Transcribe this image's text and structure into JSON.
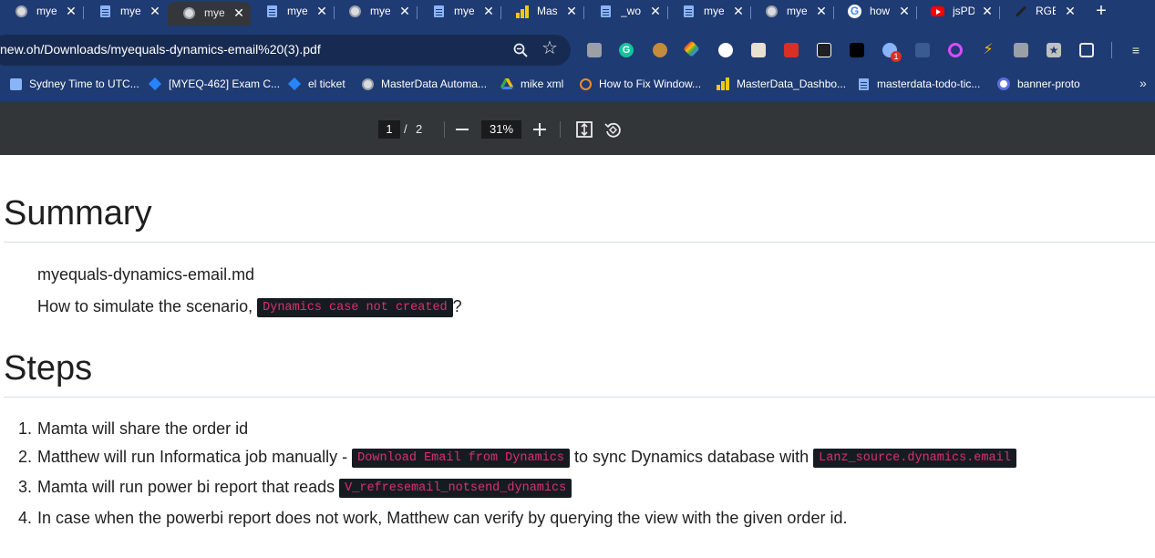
{
  "tabs": [
    {
      "title": "mye",
      "icon": "globe-icon",
      "active": false
    },
    {
      "title": "mye",
      "icon": "doc-icon",
      "active": false
    },
    {
      "title": "mye",
      "icon": "globe-icon",
      "active": true
    },
    {
      "title": "mye",
      "icon": "doc-icon",
      "active": false
    },
    {
      "title": "mye",
      "icon": "globe-icon",
      "active": false
    },
    {
      "title": "mye",
      "icon": "doc-icon",
      "active": false
    },
    {
      "title": "Mas",
      "icon": "powerbi-icon",
      "active": false
    },
    {
      "title": "_wo",
      "icon": "doc-icon",
      "active": false
    },
    {
      "title": "mye",
      "icon": "doc-icon",
      "active": false
    },
    {
      "title": "mye",
      "icon": "globe-icon",
      "active": false
    },
    {
      "title": "how",
      "icon": "google-icon",
      "active": false
    },
    {
      "title": "jsPD",
      "icon": "youtube-icon",
      "active": false
    },
    {
      "title": "RGE",
      "icon": "pen-icon",
      "active": false
    }
  ],
  "address": {
    "url": "new.oh/Downloads/myequals-dynamics-email%20(3).pdf"
  },
  "bookmarks": [
    {
      "label": "Sydney Time to UTC...",
      "icon": "clock-icon"
    },
    {
      "label": "[MYEQ-462] Exam C...",
      "icon": "jira-icon"
    },
    {
      "label": "el ticket",
      "icon": "jira-icon"
    },
    {
      "label": "MasterData Automa...",
      "icon": "globe-icon"
    },
    {
      "label": "mike xml",
      "icon": "drive-icon"
    },
    {
      "label": "How to Fix Window...",
      "icon": "bookmark-icon"
    },
    {
      "label": "MasterData_Dashbo...",
      "icon": "powerbi-icon"
    },
    {
      "label": "masterdata-todo-tic...",
      "icon": "doc-icon"
    },
    {
      "label": "banner-proto",
      "icon": "app-icon"
    }
  ],
  "pdf_toolbar": {
    "current_page": "1",
    "separator": "/",
    "total_pages": "2",
    "zoom": "31%"
  },
  "document": {
    "summary_heading": "Summary",
    "filename": "myequals-dynamics-email.md",
    "question_prefix": "How to simulate the scenario,",
    "question_code": "Dynamics case not created",
    "question_suffix": "?",
    "steps_heading": "Steps",
    "steps": [
      {
        "num": "1.",
        "text": "Mamta will share the order id"
      },
      {
        "num": "2.",
        "prefix": "Matthew will run Informatica job manually -",
        "code1": "Download Email from Dynamics",
        "middle": "to sync Dynamics database with",
        "code2": "Lanz_source.dynamics.email"
      },
      {
        "num": "3.",
        "prefix": "Mamta will run power bi report that reads",
        "code1": "V_refresemail_notsend_dynamics"
      },
      {
        "num": "4.",
        "text": "In case when the powerbi report does not work, Matthew can verify by querying the view with the given order id."
      }
    ]
  }
}
